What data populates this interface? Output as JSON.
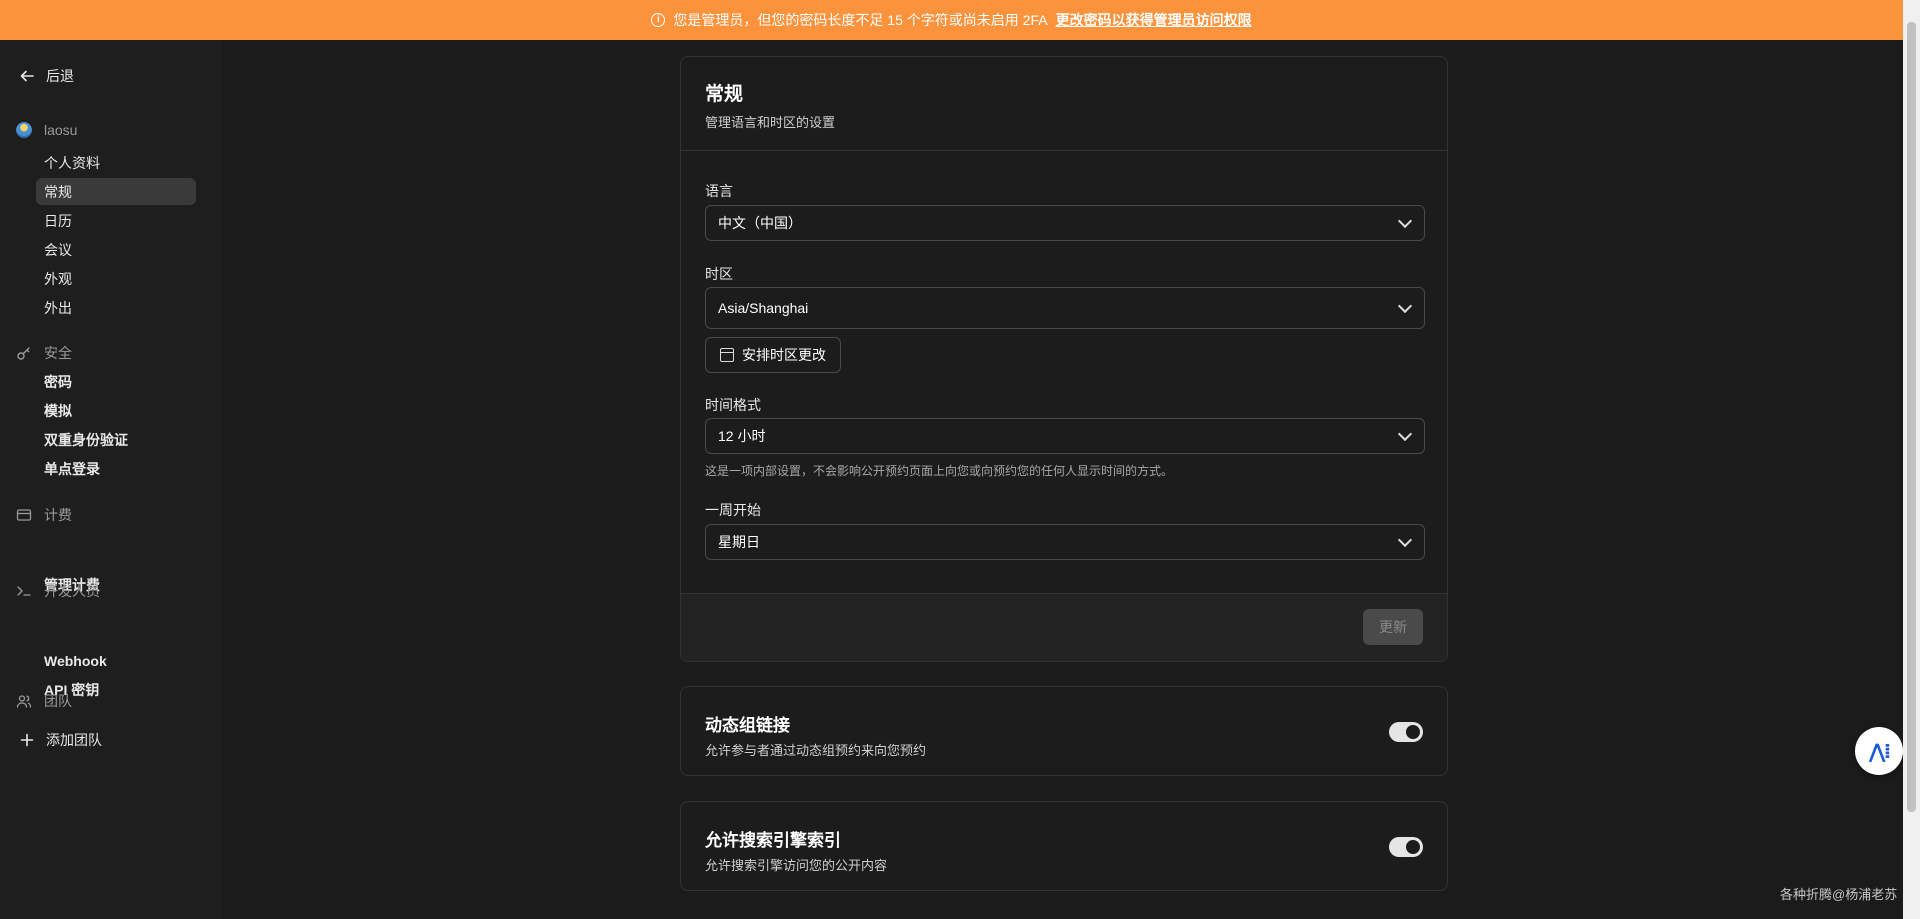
{
  "banner": {
    "text": "您是管理员，但您的密码长度不足 15 个字符或尚未启用 2FA",
    "link": "更改密码以获得管理员访问权限"
  },
  "sidebar": {
    "back": "后退",
    "user": {
      "name": "laosu",
      "items": [
        "个人资料",
        "常规",
        "日历",
        "会议",
        "外观",
        "外出"
      ],
      "active": "常规"
    },
    "security": {
      "title": "安全",
      "items": [
        "密码",
        "模拟",
        "双重身份验证",
        "单点登录"
      ]
    },
    "billing": {
      "title": "计费",
      "items": [
        "管理计费"
      ]
    },
    "developer": {
      "title": "开发人员",
      "items": [
        "Webhook",
        "API 密钥"
      ]
    },
    "teams": {
      "title": "团队",
      "add": "添加团队"
    }
  },
  "general": {
    "title": "常规",
    "subtitle": "管理语言和时区的设置",
    "language_label": "语言",
    "language_value": "中文（中国）",
    "timezone_label": "时区",
    "timezone_value": "Asia/Shanghai",
    "schedule_tz_button": "安排时区更改",
    "time_format_label": "时间格式",
    "time_format_value": "12 小时",
    "time_format_help": "这是一项内部设置，不会影响公开预约页面上向您或向预约您的任何人显示时间的方式。",
    "week_start_label": "一周开始",
    "week_start_value": "星期日",
    "update_button": "更新"
  },
  "dynamic_group": {
    "title": "动态组链接",
    "subtitle": "允许参与者通过动态组预约来向您预约",
    "enabled": true
  },
  "search_index": {
    "title": "允许搜索引擎索引",
    "subtitle": "允许搜索引擎访问您的公开内容",
    "enabled": true
  },
  "watermark": "各种折腾@杨浦老苏",
  "colors": {
    "banner": "#fb923c",
    "background": "#1b1b1b",
    "sidebar_active": "#3a3a3a"
  }
}
